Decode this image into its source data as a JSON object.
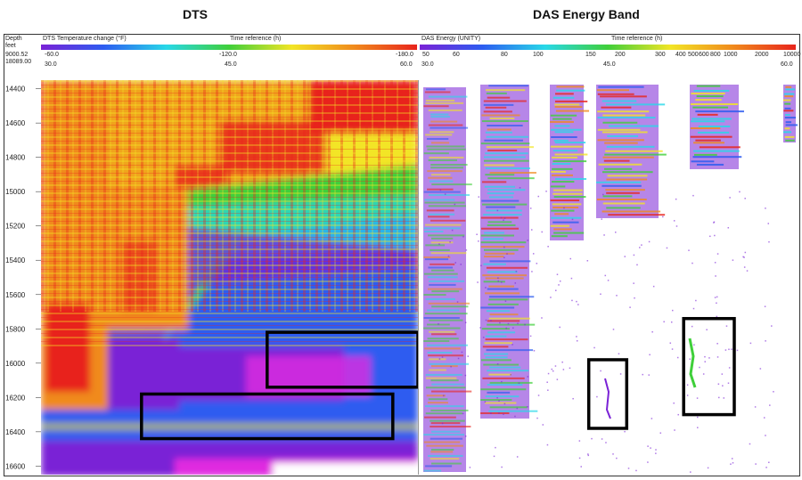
{
  "titles": {
    "dts": "DTS",
    "das": "DAS Energy Band"
  },
  "depth_header": {
    "label": "Depth",
    "unit": "feet",
    "top": "9000.52",
    "bottom": "18089.00"
  },
  "dts_header": {
    "variable": "DTS Temperature change (°F)",
    "time_label": "Time reference (h)",
    "scale_ticks": [
      "-60.0",
      "-120.0",
      "-180.0"
    ],
    "time_ticks": [
      "30.0",
      "45.0",
      "60.0"
    ]
  },
  "das_header": {
    "variable": "DAS Energy (UNITY)",
    "time_label": "Time reference (h)",
    "scale_ticks": [
      "50",
      "60",
      "80",
      "100",
      "150",
      "200",
      "300",
      "400",
      "500",
      "600",
      "800",
      "1000",
      "2000",
      "10000"
    ],
    "time_ticks": [
      "30.0",
      "45.0",
      "60.0"
    ]
  },
  "colors": {
    "violet": "#7a22d6",
    "blue": "#2d5cf0",
    "cyan": "#28d8e8",
    "green": "#3fcf3a",
    "yellow": "#f2e526",
    "orange": "#f08a1c",
    "red": "#e8241c",
    "magenta": "#e02ce0"
  },
  "chart_data": [
    {
      "type": "heatmap",
      "title": "DTS",
      "ylabel": "Depth (feet)",
      "xlabel": "Time reference (h)",
      "yticks": [
        14400,
        14600,
        14800,
        15000,
        15200,
        15400,
        15600,
        15800,
        16000,
        16200,
        16400,
        16600
      ],
      "ylim": [
        14350,
        16650
      ],
      "xlim": [
        30,
        60
      ],
      "highlight_boxes": [
        {
          "x": [
            48,
            60
          ],
          "y": [
            15820,
            16140
          ]
        },
        {
          "x": [
            38,
            58
          ],
          "y": [
            16180,
            16440
          ]
        }
      ]
    },
    {
      "type": "heatmap",
      "title": "DAS Energy Band",
      "xlabel": "Time reference (h)",
      "ylim": [
        14350,
        16650
      ],
      "xlim": [
        30,
        60
      ],
      "highlight_boxes": [
        {
          "x": [
            43.5,
            46.5
          ],
          "y": [
            15980,
            16380
          ]
        },
        {
          "x": [
            51,
            55
          ],
          "y": [
            15740,
            16300
          ]
        }
      ]
    }
  ]
}
